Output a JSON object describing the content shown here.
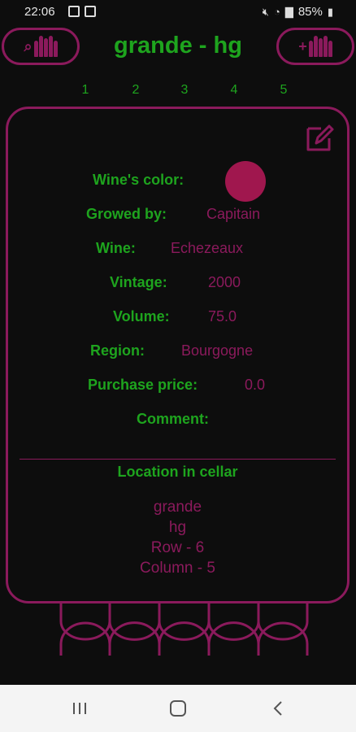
{
  "status": {
    "time": "22:06",
    "battery": "85%"
  },
  "header": {
    "title": "grande - hg"
  },
  "columns": [
    "1",
    "2",
    "3",
    "4",
    "5"
  ],
  "wine": {
    "color_label": "Wine's color:",
    "color_value": "#a0174e",
    "producer_label": "Growed by:",
    "producer_value": "Capitain",
    "wine_label": "Wine:",
    "wine_value": "Echezeaux",
    "vintage_label": "Vintage:",
    "vintage_value": "2000",
    "volume_label": "Volume:",
    "volume_value": "75.0",
    "region_label": "Region:",
    "region_value": "Bourgogne",
    "price_label": "Purchase price:",
    "price_value": "0.0",
    "comment_label": "Comment:",
    "comment_value": ""
  },
  "location": {
    "title": "Location in cellar",
    "cellar": "grande",
    "section": "hg",
    "row": "Row - 6",
    "column": "Column - 5"
  },
  "colors": {
    "accent_green": "#1ea41e",
    "accent_wine": "#8b1a5c",
    "background": "#0d0d0d"
  },
  "icons": {
    "left_button": "search-bottles-icon",
    "right_button": "add-bottles-icon",
    "edit": "edit-icon",
    "nav_recents": "recents-icon",
    "nav_home": "home-icon",
    "nav_back": "back-icon"
  }
}
